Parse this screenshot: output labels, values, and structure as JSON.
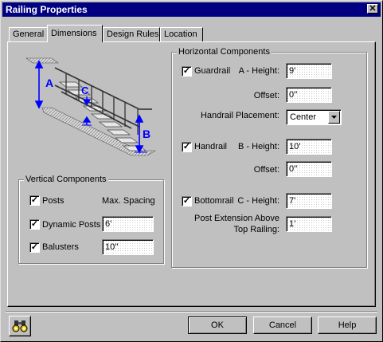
{
  "window": {
    "title": "Railing Properties",
    "close_glyph": "✕"
  },
  "tabs": [
    {
      "label": "General",
      "active": false
    },
    {
      "label": "Dimensions",
      "active": true
    },
    {
      "label": "Design Rules",
      "active": false
    },
    {
      "label": "Location",
      "active": false
    }
  ],
  "diagram": {
    "label_a": "A",
    "label_b": "B",
    "label_c": "C",
    "arrow_color": "#0000ff",
    "label_color": "#0000ff"
  },
  "vertical": {
    "title": "Vertical Components",
    "max_spacing_label": "Max. Spacing",
    "posts": {
      "label": "Posts",
      "checked": true
    },
    "dynamic_posts": {
      "label": "Dynamic Posts",
      "checked": true,
      "value": "6'"
    },
    "balusters": {
      "label": "Balusters",
      "checked": true,
      "value": "10''"
    }
  },
  "horizontal": {
    "title": "Horizontal Components",
    "guardrail": {
      "label": "Guardrail",
      "checked": true,
      "height_label": "A - Height:",
      "height_value": "9'",
      "offset_label": "Offset:",
      "offset_value": "0''"
    },
    "placement": {
      "label": "Handrail Placement:",
      "value": "Center"
    },
    "handrail": {
      "label": "Handrail",
      "checked": true,
      "height_label": "B - Height:",
      "height_value": "10'",
      "offset_label": "Offset:",
      "offset_value": "0''"
    },
    "bottomrail": {
      "label": "Bottomrail",
      "checked": true,
      "height_label": "C - Height:",
      "height_value": "7'"
    },
    "post_extension": {
      "label_line1": "Post Extension Above",
      "label_line2": "Top Railing:",
      "value": "1'"
    }
  },
  "buttons": {
    "ok": "OK",
    "cancel": "Cancel",
    "help": "Help"
  },
  "check_glyph": "✓",
  "icons": {
    "footer": "binoculars-icon"
  }
}
